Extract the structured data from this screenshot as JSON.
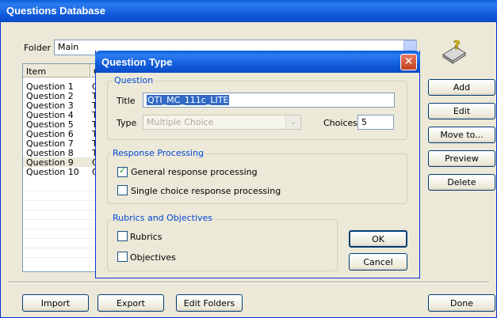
{
  "window": {
    "title": "Questions Database"
  },
  "folder": {
    "label": "Folder",
    "value": "Main"
  },
  "list": {
    "headers": [
      "Item",
      "Q"
    ],
    "rows": [
      {
        "item": "Question 1",
        "q": "Q"
      },
      {
        "item": "Question 2",
        "q": "Tl"
      },
      {
        "item": "Question 3",
        "q": "Tl"
      },
      {
        "item": "Question 4",
        "q": "Tl"
      },
      {
        "item": "Question 5",
        "q": "Tl"
      },
      {
        "item": "Question 6",
        "q": "Tl"
      },
      {
        "item": "Question 7",
        "q": "Tl"
      },
      {
        "item": "Question 8",
        "q": "Tl"
      },
      {
        "item": "Question 9",
        "q": "Q"
      },
      {
        "item": "Question 10",
        "q": "Q"
      }
    ],
    "selected_index": 8
  },
  "right_buttons": {
    "add": "Add",
    "edit": "Edit",
    "move": "Move to...",
    "preview": "Preview",
    "delete": "Delete"
  },
  "bottom_buttons": {
    "import": "Import",
    "export": "Export",
    "edit_folders": "Edit Folders",
    "done": "Done"
  },
  "dialog": {
    "title": "Question Type",
    "question_group": "Question",
    "title_label": "Title",
    "title_value": "QTI_MC_111c_LITE",
    "type_label": "Type",
    "type_value": "Multiple Choice",
    "choices_label": "Choices",
    "choices_value": "5",
    "response_group": "Response Processing",
    "general_label": "General response processing",
    "general_checked": true,
    "single_label": "Single choice response processing",
    "single_checked": false,
    "rubrics_group": "Rubrics and Objectives",
    "rubrics_label": "Rubrics",
    "objectives_label": "Objectives",
    "ok": "OK",
    "cancel": "Cancel"
  },
  "icons": [
    "help-book-icon",
    "close-icon",
    "dropdown-arrow-icon",
    "checkmark-icon"
  ]
}
